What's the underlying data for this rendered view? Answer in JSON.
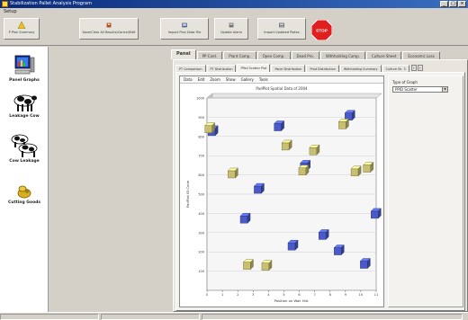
{
  "window": {
    "title": "Stabilization Pallet Analysis Program",
    "controls": {
      "minimize": "_",
      "maximize": "□",
      "close": "×"
    }
  },
  "menubar": {
    "items": [
      "Setup"
    ]
  },
  "toolbar": {
    "buttons": [
      {
        "label": "P Plan Summary",
        "icon": "warning-cone-icon"
      },
      {
        "label": "Save/Clear All Results/Cancel/Edit",
        "icon": "save-clear-icon"
      },
      {
        "label": "Import Plan Data File",
        "icon": "import-icon"
      },
      {
        "label": "Update Alarm",
        "icon": "update-icon"
      },
      {
        "label": "Import Updated Plates",
        "icon": "import-plates-icon"
      }
    ],
    "stop_label": "STOP"
  },
  "left_panel": {
    "items": [
      {
        "label": "Panel Graphs",
        "icon": "panel-graphs-icon"
      },
      {
        "label": "Leakage Cow",
        "icon": "cow-icon"
      },
      {
        "label": "Cow Leakage",
        "icon": "cow-leakage-icon"
      },
      {
        "label": "Cutting Goods",
        "icon": "cutting-goods-icon"
      }
    ]
  },
  "tabs_level1": {
    "items": [
      "Panel",
      "PP Cont.",
      "Plant Comp.",
      "Open Comp.",
      "Dead Pro.",
      "Withholding Comp.",
      "Culture Sheet",
      "Economic Loss"
    ],
    "active_index": 0
  },
  "tabs_level2": {
    "items": [
      "PT Comparison",
      "PT Distribution",
      "PPad Scatter Plot",
      "Panel Distribution",
      "Prod Distribution",
      "Withholding Summary",
      "Culture Sh. 3"
    ],
    "active_index": 2,
    "arrow_left": "‹",
    "arrow_right": "›"
  },
  "chart_menu": {
    "items": [
      "Data",
      "Edit",
      "Zoom",
      "Show",
      "Gallery",
      "Tools"
    ]
  },
  "side_options": {
    "label": "Type of Graph",
    "selected": "PPID Scatter"
  },
  "chart_data": {
    "type": "scatter",
    "title": "PadPlot Spatial Data of 2004",
    "xlabel": "Position on Wall Hdr.",
    "ylabel": "PadPlot ID Code",
    "xlim": [
      0,
      11
    ],
    "ylim": [
      0,
      1000
    ],
    "xticks": [
      0,
      1,
      2,
      3,
      4,
      5,
      6,
      7,
      8,
      9,
      10,
      11
    ],
    "yticks": [
      100,
      200,
      300,
      400,
      500,
      600,
      700,
      800,
      900,
      1000
    ],
    "series": [
      {
        "color": "#4a5ac8",
        "points": [
          [
            0.3,
            830
          ],
          [
            2.4,
            375
          ],
          [
            3.3,
            530
          ],
          [
            4.6,
            855
          ],
          [
            5.5,
            235
          ],
          [
            6.3,
            650
          ],
          [
            7.5,
            290
          ],
          [
            8.5,
            210
          ],
          [
            9.2,
            910
          ],
          [
            10.2,
            140
          ],
          [
            10.9,
            400
          ]
        ]
      },
      {
        "color": "#c8c070",
        "points": [
          [
            0.1,
            845
          ],
          [
            1.6,
            610
          ],
          [
            2.6,
            135
          ],
          [
            3.8,
            130
          ],
          [
            5.1,
            755
          ],
          [
            6.2,
            625
          ],
          [
            6.9,
            730
          ],
          [
            8.8,
            865
          ],
          [
            9.6,
            620
          ],
          [
            10.4,
            640
          ]
        ]
      }
    ],
    "grid": true
  },
  "statusbar": {
    "cells": [
      "",
      "",
      ""
    ]
  }
}
